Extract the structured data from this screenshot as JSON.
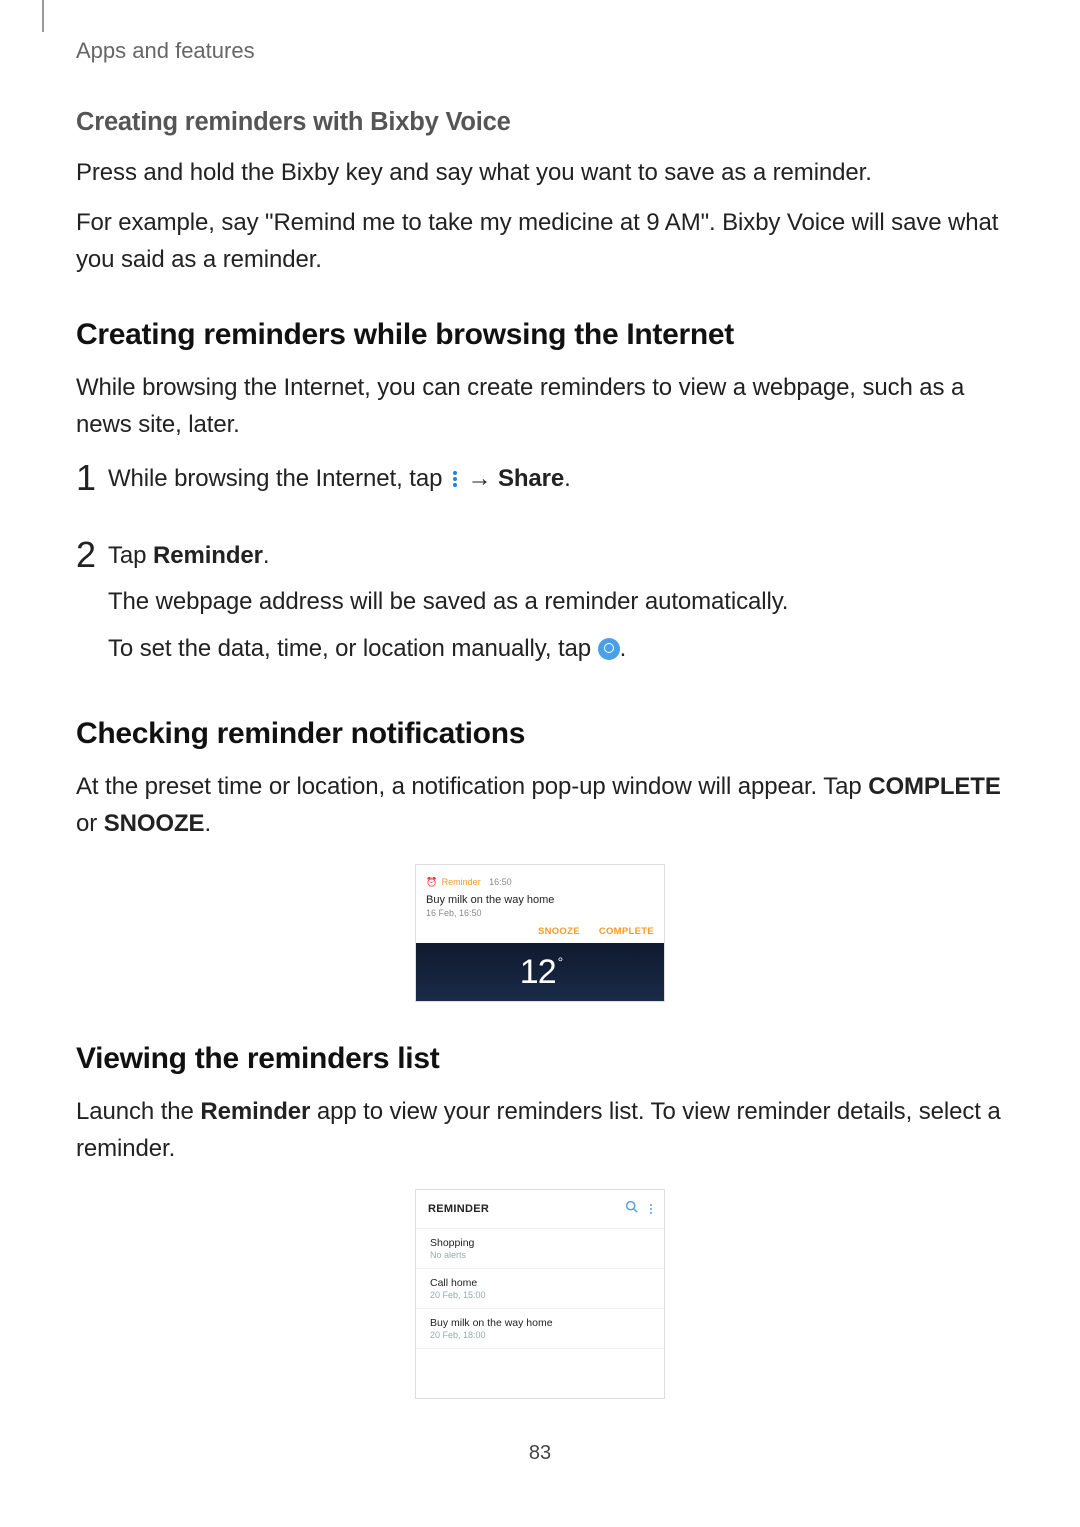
{
  "header": {
    "running": "Apps and features"
  },
  "sec1": {
    "title": "Creating reminders with Bixby Voice",
    "p1": "Press and hold the Bixby key and say what you want to save as a reminder.",
    "p2a": "For example, say \"Remind me to take my medicine at 9 AM\". Bixby Voice will save what you said as a reminder."
  },
  "sec2": {
    "title": "Creating reminders while browsing the Internet",
    "intro": "While browsing the Internet, you can create reminders to view a webpage, such as a news site, later.",
    "step1": {
      "num": "1",
      "pre": "While browsing the Internet, tap ",
      "arrow": " → ",
      "share": "Share",
      "post": "."
    },
    "step2": {
      "num": "2",
      "line1a": "Tap ",
      "line1b": "Reminder",
      "line1c": ".",
      "line2": "The webpage address will be saved as a reminder automatically.",
      "line3a": "To set the data, time, or location manually, tap ",
      "line3b": "."
    }
  },
  "sec3": {
    "title": "Checking reminder notifications",
    "p_a": "At the preset time or location, a notification pop-up window will appear. Tap ",
    "complete": "COMPLETE",
    "p_b": " or ",
    "snooze": "SNOOZE",
    "p_c": "."
  },
  "fig1": {
    "app": "Reminder",
    "time": "16:50",
    "title": "Buy milk on the way home",
    "date": "16 Feb, 16:50",
    "action_snooze": "SNOOZE",
    "action_complete": "COMPLETE",
    "temp": "12",
    "deg": "°"
  },
  "sec4": {
    "title": "Viewing the reminders list",
    "p_a": "Launch the ",
    "app": "Reminder",
    "p_b": " app to view your reminders list. To view reminder details, select a reminder."
  },
  "fig2": {
    "header": "REMINDER",
    "items": [
      {
        "title": "Shopping",
        "sub": "No alerts"
      },
      {
        "title": "Call home",
        "sub": "20 Feb, 15:00"
      },
      {
        "title": "Buy milk on the way home",
        "sub": "20 Feb, 18:00"
      }
    ]
  },
  "page_number": "83"
}
